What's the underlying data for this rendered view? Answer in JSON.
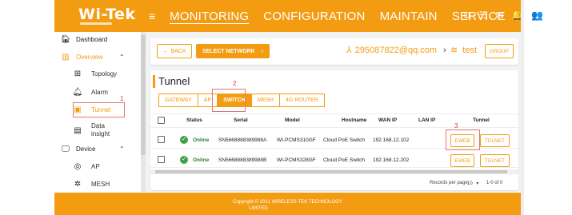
{
  "brand": {
    "logo_text": "Wi-Tek"
  },
  "nav": {
    "items": [
      "MONITORING",
      "CONFIGURATION",
      "MAINTAIN",
      "SERVICE"
    ],
    "active": "MONITORING"
  },
  "sidebar": {
    "dashboard": "Dashboard",
    "overview": "Overview",
    "topology": "Topology",
    "alarm": "Alarm",
    "tunnel": "Tunnel",
    "data_insight_1": "Data",
    "data_insight_2": "insight",
    "device": "Device",
    "ap": "AP",
    "mesh": "MESH"
  },
  "annotations": {
    "n1": "1",
    "n2": "2",
    "n3": "3"
  },
  "toolbar": {
    "back_label": "BACK",
    "select_network_label": "SELECT NETWORK",
    "account": "295087822@qq.com",
    "network": "test",
    "group_label": "GROUP"
  },
  "page": {
    "title": "Tunnel"
  },
  "tabs": [
    "GATEWAY",
    "AP",
    "SWITCH",
    "MESH",
    "4G ROUTER"
  ],
  "active_tab": "SWITCH",
  "table": {
    "headers": {
      "status": "Status",
      "serial": "Serial",
      "model": "Model",
      "hostname": "Hostname",
      "wan_ip": "WAN IP",
      "lan_ip": "LAN IP",
      "tunnel": "Tunnel"
    },
    "rows": [
      {
        "status": "Online",
        "serial": "SN5668888389988A",
        "model": "WI-PCMS310GF",
        "hostname": "Cloud PoE Switch",
        "wan_ip": "192.168.12.102",
        "lan_ip": "",
        "eweb": "EWEB",
        "telnet": "TELNET"
      },
      {
        "status": "Online",
        "serial": "SN5668888389988B",
        "model": "WI-PCMS328GF",
        "hostname": "Cloud PoE Switch",
        "wan_ip": "192.168.12.202",
        "lan_ip": "",
        "eweb": "EWEB",
        "telnet": "TELNET"
      }
    ]
  },
  "pagination": {
    "records_label": "Records per page:",
    "per_page": "10",
    "range": "1-0 of 0"
  },
  "footer": {
    "line1": "Copyright © 2021 WIRELESS-TEK TECHNOLOGY",
    "line2": "LIMITED"
  },
  "colors": {
    "accent": "#f39c12",
    "online": "#43a047",
    "highlight": "#e57373"
  }
}
